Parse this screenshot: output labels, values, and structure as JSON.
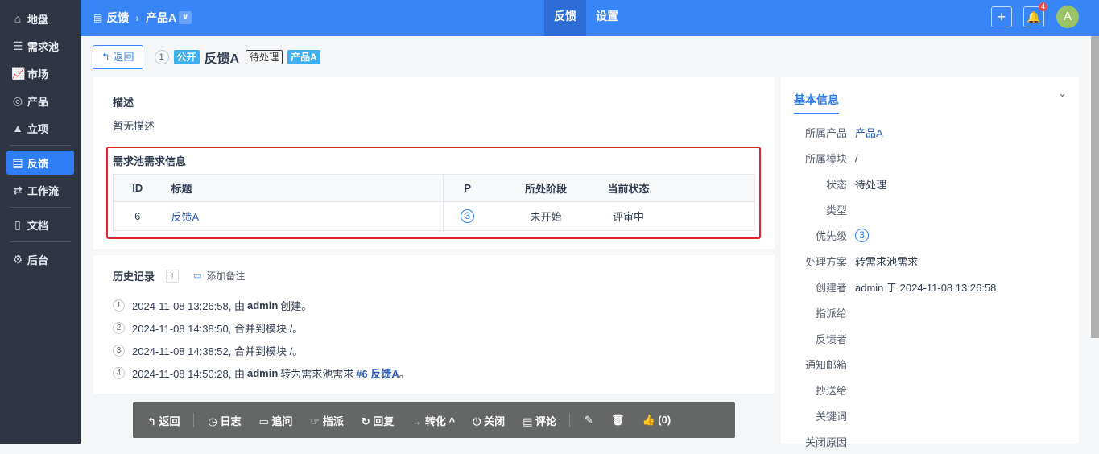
{
  "sidebar": {
    "items": [
      {
        "label": "地盘",
        "icon": "home-icon"
      },
      {
        "label": "需求池",
        "icon": "list-icon"
      },
      {
        "label": "市场",
        "icon": "chart-icon"
      },
      {
        "label": "产品",
        "icon": "bulb-icon"
      },
      {
        "label": "立项",
        "icon": "rocket-icon"
      },
      {
        "label": "反馈",
        "icon": "feedback-icon"
      },
      {
        "label": "工作流",
        "icon": "flow-icon"
      },
      {
        "label": "文档",
        "icon": "doc-icon"
      },
      {
        "label": "后台",
        "icon": "gear-icon"
      }
    ]
  },
  "topbar": {
    "crumb1": "反馈",
    "crumb2": "产品A",
    "nav": [
      "反馈",
      "设置"
    ],
    "bell_count": "4",
    "avatar": "A"
  },
  "header": {
    "back": "返回",
    "id": "1",
    "public": "公开",
    "title": "反馈A",
    "status": "待处理",
    "product": "产品A"
  },
  "desc": {
    "title": "描述",
    "body": "暂无描述"
  },
  "pool": {
    "title": "需求池需求信息",
    "columns": [
      "ID",
      "标题",
      "P",
      "所处阶段",
      "当前状态"
    ],
    "rows": [
      {
        "id": "6",
        "title": "反馈A",
        "p": "3",
        "stage": "未开始",
        "state": "评审中"
      }
    ]
  },
  "history": {
    "title": "历史记录",
    "add_note": "添加备注",
    "items": [
      {
        "n": "1",
        "time": "2024-11-08 13:26:58, 由 ",
        "who": "admin",
        "rest": " 创建。"
      },
      {
        "n": "2",
        "time": "2024-11-08 14:38:50, 合并到模块 /。",
        "who": "",
        "rest": ""
      },
      {
        "n": "3",
        "time": "2024-11-08 14:38:52, 合并到模块 /。",
        "who": "",
        "rest": ""
      },
      {
        "n": "4",
        "time": "2024-11-08 14:50:28, 由 ",
        "who": "admin",
        "rest": " 转为需求池需求 ",
        "link": "#6 反馈A",
        "end": " 。"
      }
    ]
  },
  "toolbar": {
    "back": "返回",
    "log": "日志",
    "ask": "追问",
    "assign": "指派",
    "reply": "回复",
    "convert": "转化",
    "close": "关闭",
    "comment": "评论",
    "like": "(0)"
  },
  "info": {
    "title": "基本信息",
    "rows": [
      {
        "k": "所属产品",
        "v": "产品A"
      },
      {
        "k": "所属模块",
        "v": "/"
      },
      {
        "k": "状态",
        "v": "待处理"
      },
      {
        "k": "类型",
        "v": ""
      },
      {
        "k": "优先级",
        "v": "3"
      },
      {
        "k": "处理方案",
        "v": "转需求池需求"
      },
      {
        "k": "创建者",
        "v": "admin 于 2024-11-08 13:26:58"
      },
      {
        "k": "指派给",
        "v": ""
      },
      {
        "k": "反馈者",
        "v": ""
      },
      {
        "k": "通知邮箱",
        "v": ""
      },
      {
        "k": "抄送给",
        "v": ""
      },
      {
        "k": "关键词",
        "v": ""
      },
      {
        "k": "关闭原因",
        "v": ""
      }
    ]
  }
}
